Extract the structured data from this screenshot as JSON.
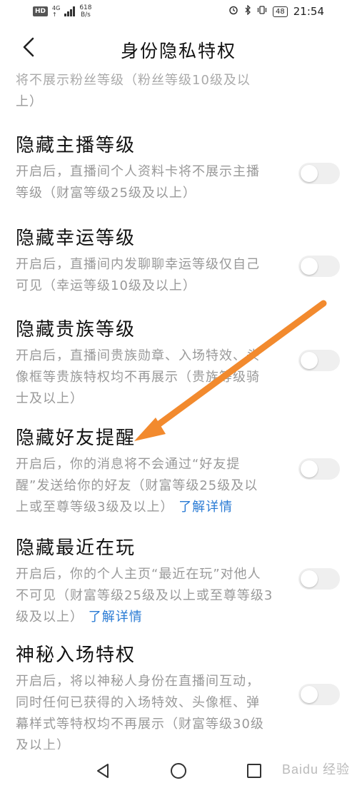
{
  "status_bar": {
    "hd": "HD",
    "network_top": "4G",
    "network_bottom": "↑",
    "speed_value": "618",
    "speed_unit": "B/s",
    "battery": "48",
    "time": "21:54"
  },
  "header": {
    "title": "身份隐私特权"
  },
  "sections": [
    {
      "title": "",
      "desc": "将不展示粉丝等级（粉丝等级10级及以上）",
      "desc_lines": [
        "将不展示粉丝等级（粉丝等级10级及以",
        "上）"
      ],
      "link": ""
    },
    {
      "title": "隐藏主播等级",
      "desc_lines": [
        "开启后，直播间个人资料卡将不展示主播",
        "等级（财富等级25级及以上）"
      ],
      "link": "",
      "toggle_on": false
    },
    {
      "title": "隐藏幸运等级",
      "desc_lines": [
        "开启后，直播间内发聊聊幸运等级仅自己",
        "可见（幸运等级10级及以上）"
      ],
      "link": "",
      "toggle_on": false
    },
    {
      "title": "隐藏贵族等级",
      "desc_lines": [
        "开启后，直播间贵族勋章、入场特效、头",
        "像框等贵族特权均不再展示（贵族等级骑",
        "士及以上）"
      ],
      "link": "",
      "toggle_on": false
    },
    {
      "title": "隐藏好友提醒",
      "desc_lines": [
        "开启后，你的消息将不会通过“好友提",
        "醒”发送给你的好友（财富等级25级及以",
        "上或至尊等级3级及以上）"
      ],
      "link": "了解详情",
      "toggle_on": false
    },
    {
      "title": "隐藏最近在玩",
      "desc_lines": [
        "开启后，你的个人主页“最近在玩”对他人",
        "不可见（财富等级25级及以上或至尊等级3",
        "级及以上）"
      ],
      "link": "了解详情",
      "toggle_on": false
    },
    {
      "title": "神秘入场特权",
      "desc_lines": [
        "开启后，将以神秘人身份在直播间互动，",
        "同时任何已获得的入场特效、头像框、弹",
        "幕样式等特权均不再展示（财富等级30级",
        "及以上）"
      ],
      "link": "",
      "toggle_on": false
    }
  ],
  "watermark": "Baidu 经验",
  "colors": {
    "arrow": "#f28a2e",
    "link": "#2a7bd4",
    "toggle_off": "#efefef"
  }
}
